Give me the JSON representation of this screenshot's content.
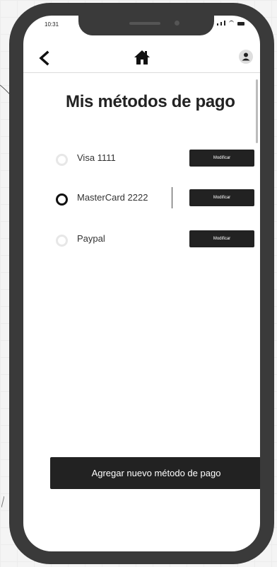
{
  "status_bar": {
    "time": "10:31"
  },
  "header": {
    "back_icon": "chevron-left-icon",
    "home_icon": "home-icon",
    "profile_icon": "user-icon"
  },
  "page": {
    "title": "Mis métodos de pago"
  },
  "payment_methods": [
    {
      "label": "Visa 1111",
      "selected": false,
      "modify_label": "Modificar"
    },
    {
      "label": "MasterCard 2222",
      "selected": true,
      "modify_label": "Modificar"
    },
    {
      "label": "Paypal",
      "selected": false,
      "modify_label": "Modificar"
    }
  ],
  "add_button": {
    "label": "Agregar nuevo método de pago"
  },
  "colors": {
    "frame": "#3a3a3a",
    "button": "#222222",
    "radio_unselected": "#e7e7e7",
    "radio_selected": "#111111"
  }
}
